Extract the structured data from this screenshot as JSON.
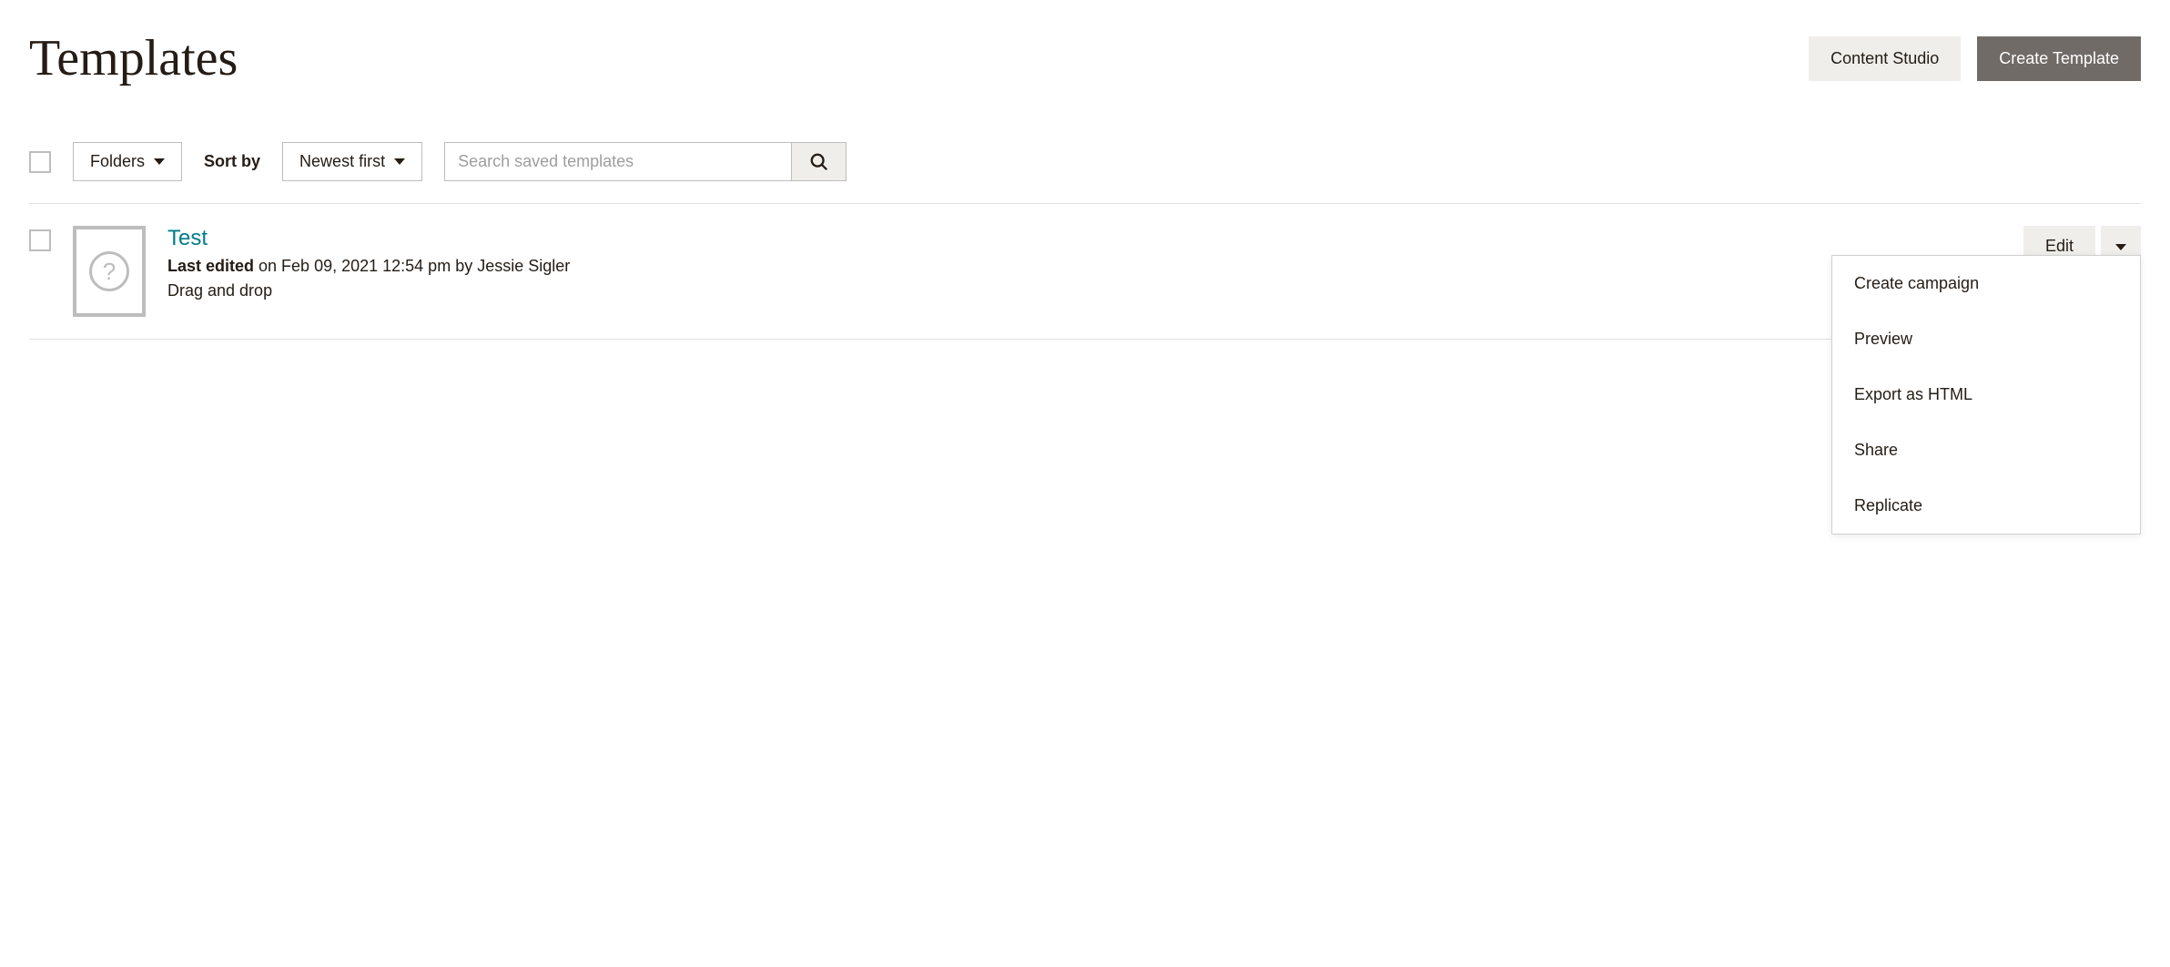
{
  "header": {
    "title": "Templates",
    "content_studio_label": "Content Studio",
    "create_template_label": "Create Template"
  },
  "toolbar": {
    "folders_label": "Folders",
    "sortby_label": "Sort by",
    "sort_selected": "Newest first",
    "search_placeholder": "Search saved templates"
  },
  "templates": [
    {
      "title": "Test",
      "last_edited_prefix": "Last edited",
      "last_edited_rest": " on Feb 09, 2021 12:54 pm by Jessie Sigler",
      "type": "Drag and drop",
      "edit_label": "Edit"
    }
  ],
  "dropdown": {
    "items": [
      "Create campaign",
      "Preview",
      "Export as HTML",
      "Share",
      "Replicate"
    ]
  }
}
